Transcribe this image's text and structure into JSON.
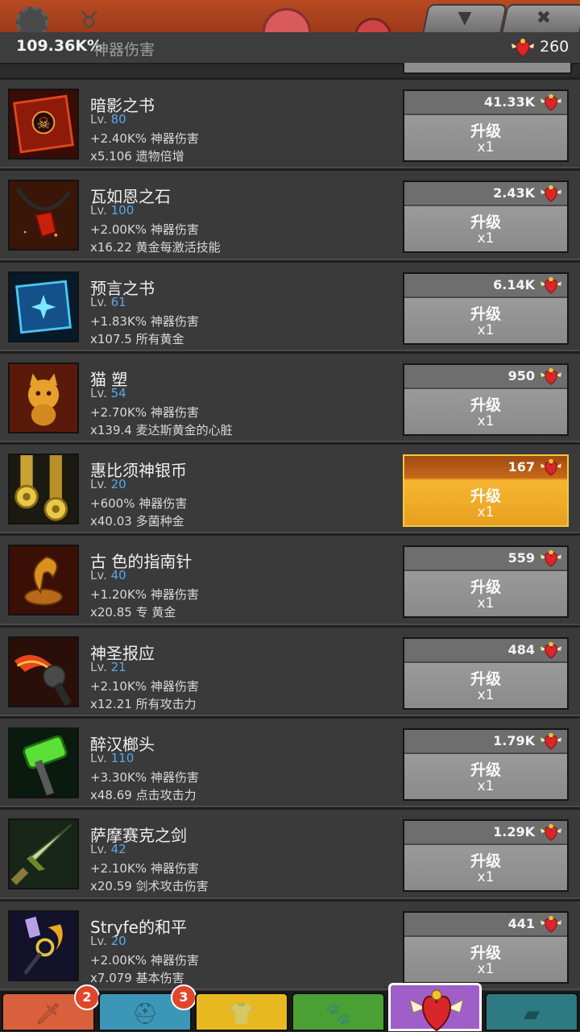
{
  "header": {
    "total_damage_value": "109.36K%",
    "total_damage_label": "神器伤害",
    "relic_count": "260"
  },
  "artifacts": [
    {
      "name": "暗影之书",
      "level_prefix": "Lv.",
      "level": "80",
      "effect1": "+2.40K% 神器伤害",
      "effect2": "x5.106 遗物倍增",
      "cost": "41.33K",
      "action": "升级",
      "mult": "x1",
      "active": false,
      "icon": "book-of-shadows-icon"
    },
    {
      "name": "瓦如恩之石",
      "level_prefix": "Lv.",
      "level": "100",
      "effect1": "+2.00K% 神器伤害",
      "effect2": "x16.22 黄金每激活技能",
      "cost": "2.43K",
      "action": "升级",
      "mult": "x1",
      "active": false,
      "icon": "red-stone-necklace-icon"
    },
    {
      "name": "预言之书",
      "level_prefix": "Lv.",
      "level": "61",
      "effect1": "+1.83K% 神器伤害",
      "effect2": "x107.5 所有黄金",
      "cost": "6.14K",
      "action": "升级",
      "mult": "x1",
      "active": false,
      "icon": "book-of-prophecy-icon"
    },
    {
      "name": "猫 塑",
      "level_prefix": "Lv.",
      "level": "54",
      "effect1": "+2.70K% 神器伤害",
      "effect2": "x139.4 麦达斯黄金的心脏",
      "cost": "950",
      "action": "升级",
      "mult": "x1",
      "active": false,
      "icon": "cat-statue-icon"
    },
    {
      "name": "惠比须神银币",
      "level_prefix": "Lv.",
      "level": "20",
      "effect1": "+600% 神器伤害",
      "effect2": "x40.03 多菌种金",
      "cost": "167",
      "action": "升级",
      "mult": "x1",
      "active": true,
      "icon": "gold-coins-icon"
    },
    {
      "name": "古 色的指南针",
      "level_prefix": "Lv.",
      "level": "40",
      "effect1": "+1.20K% 神器伤害",
      "effect2": "x20.85 专 黄金",
      "cost": "559",
      "action": "升级",
      "mult": "x1",
      "active": false,
      "icon": "winged-compass-icon"
    },
    {
      "name": "神圣报应",
      "level_prefix": "Lv.",
      "level": "21",
      "effect1": "+2.10K% 神器伤害",
      "effect2": "x12.21 所有攻击力",
      "cost": "484",
      "action": "升级",
      "mult": "x1",
      "active": false,
      "icon": "flaming-mace-icon"
    },
    {
      "name": "醉汉榔头",
      "level_prefix": "Lv.",
      "level": "110",
      "effect1": "+3.30K% 神器伤害",
      "effect2": "x48.69 点击攻击力",
      "cost": "1.79K",
      "action": "升级",
      "mult": "x1",
      "active": false,
      "icon": "green-hammer-icon"
    },
    {
      "name": "萨摩赛克之剑",
      "level_prefix": "Lv.",
      "level": "42",
      "effect1": "+2.10K% 神器伤害",
      "effect2": "x20.59 剑术攻击伤害",
      "cost": "1.29K",
      "action": "升级",
      "mult": "x1",
      "active": false,
      "icon": "green-sword-icon"
    },
    {
      "name": "Stryfe的和平",
      "level_prefix": "Lv.",
      "level": "20",
      "effect1": "+2.00K% 神器伤害",
      "effect2": "x7.079 基本伤害",
      "cost": "441",
      "action": "升级",
      "mult": "x1",
      "active": false,
      "icon": "crystal-staff-icon"
    }
  ],
  "tabs": [
    {
      "name": "sword",
      "badge": "2",
      "color": "#d9603c",
      "icon": "sword-icon"
    },
    {
      "name": "heroes",
      "badge": "3",
      "color": "#3c96b8",
      "icon": "viking-helmet-icon"
    },
    {
      "name": "equipment",
      "badge": "",
      "color": "#e8b820",
      "icon": "shirt-icon"
    },
    {
      "name": "pets",
      "badge": "",
      "color": "#4aa032",
      "icon": "pet-icon"
    },
    {
      "name": "artifacts",
      "badge": "",
      "color": "#a05ec8",
      "icon": "winged-heart-icon"
    },
    {
      "name": "shop",
      "badge": "",
      "color": "#2e7a82",
      "icon": "chest-icon"
    }
  ],
  "colors": {
    "level_blue": "#5aa8e8",
    "active_orange": "#f6b632",
    "upgrade_gray": "#9a9a9a"
  }
}
